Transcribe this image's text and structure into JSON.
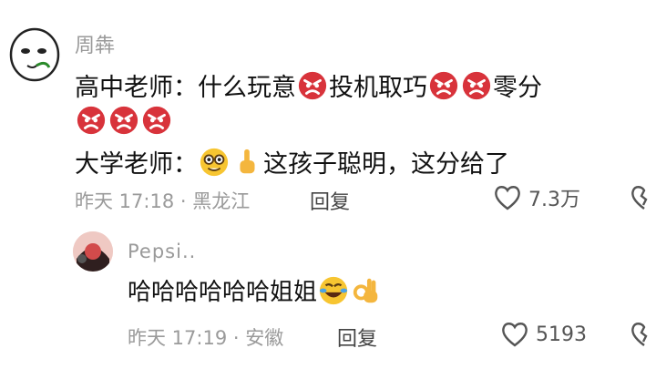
{
  "comment": {
    "username": "周犇",
    "line1_prefix": "高中老师：什么玩意",
    "line1_mid": "投机取巧",
    "line1_suffix": "零分",
    "line3_prefix": "大学老师：",
    "line3_suffix": "这孩子聪明，这分给了",
    "meta": "昨天 17:18 · 黑龙江",
    "reply_label": "回复",
    "likes": "7.3万"
  },
  "reply": {
    "username": "Pepsi..",
    "text": "哈哈哈哈哈哈姐姐",
    "meta": "昨天 17:19 · 安徽",
    "reply_label": "回复",
    "likes": "5193"
  },
  "icons": {
    "angry": "angry-face-icon",
    "nerd": "nerd-face-icon",
    "point": "pointing-up-icon",
    "laugh": "rolling-laughing-icon",
    "ok": "ok-hand-icon",
    "heart": "heart-outline-icon",
    "broken_heart": "broken-heart-icon"
  },
  "colors": {
    "angry_red": "#d8333b",
    "meta_gray": "#9a9a9a"
  }
}
